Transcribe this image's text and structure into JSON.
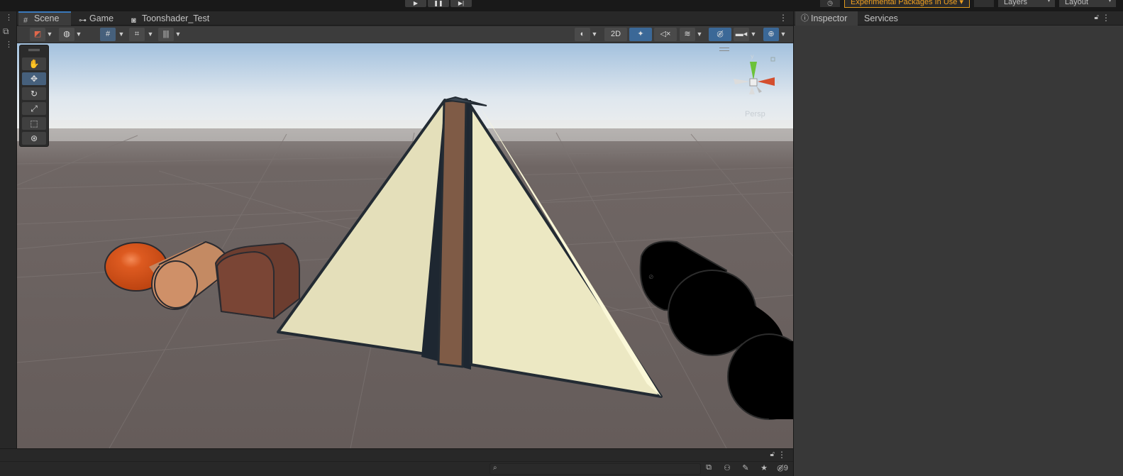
{
  "top": {
    "play_icon": "play-icon",
    "pause_icon": "pause-icon",
    "step_icon": "step-icon",
    "history_icon": "history-icon",
    "experimental_badge": "Experimental Packages In Use ▾",
    "search_icon": "search-icon",
    "layers_label": "Layers",
    "layout_label": "Layout"
  },
  "scene_tabs": [
    {
      "label": "Scene",
      "icon": "hash-icon"
    },
    {
      "label": "Game",
      "icon": "gamepad-icon"
    },
    {
      "label": "Toonshader_Test",
      "icon": "shader-icon"
    }
  ],
  "toolbar": {
    "toggle_2d": "2D"
  },
  "viewport": {
    "persp_label": "Persp",
    "gizmo_axes": [
      "y",
      "x"
    ],
    "colors": {
      "sky_top": "#a9c6e0",
      "sky_horizon": "#ebeef0",
      "ground": "#6b6260",
      "pyramid_light": "#e3deba",
      "pyramid_bright": "#f7f4d3",
      "pillar": "#7e5a45",
      "sphere": "#d4541c",
      "cylinder": "#c48a63",
      "box": "#6b3c2e",
      "outline": "#232b33"
    }
  },
  "inspector": {
    "tabs": [
      {
        "label": "Inspector",
        "icon": "info-icon"
      },
      {
        "label": "Services"
      }
    ]
  },
  "bottom": {
    "hidden_count": "9"
  }
}
